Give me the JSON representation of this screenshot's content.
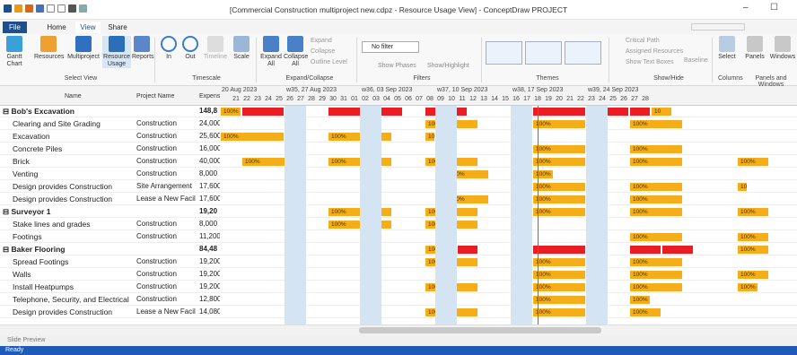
{
  "window": {
    "title": "[Commercial Construction multiproject new.cdpz - Resource Usage View] - ConceptDraw PROJECT",
    "min": "–",
    "max": "☐"
  },
  "tabs": [
    {
      "label": "File"
    },
    {
      "label": "Home"
    },
    {
      "label": "View"
    },
    {
      "label": "Share"
    }
  ],
  "ribbon": {
    "select_view": [
      {
        "label": "Gantt Chart"
      },
      {
        "label": "Resources"
      },
      {
        "label": "Multiproject"
      },
      {
        "label": "Resource Usage"
      },
      {
        "label": "Reports"
      }
    ],
    "select_view_label": "Select View",
    "timescale": [
      {
        "label": "In"
      },
      {
        "label": "Out"
      },
      {
        "label": "Timeline"
      },
      {
        "label": "Scale"
      }
    ],
    "timescale_label": "Timescale",
    "expand": [
      {
        "label": "Expand All"
      },
      {
        "label": "Collapse All"
      }
    ],
    "expand_small": [
      "Expand",
      "Collapse",
      "Outline Level"
    ],
    "expand_label": "Expand/Collapse",
    "filter_value": "No filter",
    "filters_small": [
      "Show Phases",
      "Show/Highlight"
    ],
    "filters_label": "Filters",
    "themes_label": "Themes",
    "showhide_small": [
      "Critical Path",
      "Assigned Resources",
      "Show Text Boxes",
      "Baseline"
    ],
    "showhide_label": "Show/Hide",
    "columns": [
      {
        "label": "Select"
      }
    ],
    "columns_label": "Columns",
    "windows": [
      {
        "label": "Panels"
      },
      {
        "label": "Windows"
      }
    ],
    "windows_label": "Panels and Windows"
  },
  "grid": {
    "headers": {
      "name": "Name",
      "project": "Project Name",
      "expense": "Expense"
    },
    "weeks": [
      "20 Aug 2023",
      "w35, 27 Aug 2023",
      "w36, 03 Sep 2023",
      "w37, 10 Sep 2023",
      "w38, 17 Sep 2023",
      "w39, 24 Sep 2023"
    ],
    "days": [
      "21",
      "22",
      "23",
      "24",
      "25",
      "26",
      "27",
      "28",
      "29",
      "30",
      "31",
      "01",
      "02",
      "03",
      "04",
      "05",
      "06",
      "07",
      "08",
      "09",
      "10",
      "11",
      "12",
      "13",
      "14",
      "15",
      "16",
      "17",
      "18",
      "19",
      "20",
      "21",
      "22",
      "23",
      "24",
      "25",
      "26",
      "27",
      "28"
    ],
    "rows": [
      {
        "name": "Bob's Excavation",
        "project": "",
        "expense": "148,8",
        "group": true,
        "bars": [
          {
            "s": 0,
            "w": 2,
            "c": "o",
            "t": "100%"
          },
          {
            "s": 2,
            "w": 4,
            "c": "r",
            "t": ""
          },
          {
            "s": 10,
            "w": 7,
            "c": "r",
            "t": ""
          },
          {
            "s": 19,
            "w": 2,
            "c": "r",
            "t": ""
          },
          {
            "s": 21,
            "w": 2,
            "c": "r",
            "t": ""
          },
          {
            "s": 29,
            "w": 2,
            "c": "r",
            "t": ""
          },
          {
            "s": 31,
            "w": 3,
            "c": "r",
            "t": ""
          },
          {
            "s": 38,
            "w": 2,
            "c": "r",
            "t": ""
          },
          {
            "s": 29,
            "w": 3,
            "c": "r",
            "t": ""
          },
          {
            "s": 35,
            "w": 3,
            "c": "r",
            "t": ""
          },
          {
            "s": 40,
            "w": 2,
            "c": "o",
            "t": "10"
          }
        ]
      },
      {
        "name": "Clearing and Site Grading",
        "project": "Construction",
        "expense": "24,000",
        "bars": [
          {
            "s": 19,
            "w": 5,
            "c": "o",
            "t": "100%"
          },
          {
            "s": 29,
            "w": 5,
            "c": "o",
            "t": "100%"
          },
          {
            "s": 38,
            "w": 5,
            "c": "o",
            "t": "100%"
          }
        ]
      },
      {
        "name": "Excavation",
        "project": "Construction",
        "expense": "25,600",
        "bars": [
          {
            "s": 0,
            "w": 6,
            "c": "o",
            "t": "100%"
          },
          {
            "s": 10,
            "w": 6,
            "c": "o",
            "t": "100%"
          },
          {
            "s": 19,
            "w": 1,
            "c": "o",
            "t": "10"
          }
        ]
      },
      {
        "name": "Concrete Piles",
        "project": "Construction",
        "expense": "16,000",
        "bars": [
          {
            "s": 29,
            "w": 5,
            "c": "o",
            "t": "100%"
          },
          {
            "s": 38,
            "w": 5,
            "c": "o",
            "t": "100%"
          }
        ]
      },
      {
        "name": "Brick",
        "project": "Construction",
        "expense": "40,000",
        "bars": [
          {
            "s": 2,
            "w": 5,
            "c": "o",
            "t": "100%"
          },
          {
            "s": 10,
            "w": 6,
            "c": "o",
            "t": "100%"
          },
          {
            "s": 19,
            "w": 5,
            "c": "o",
            "t": "100%"
          },
          {
            "s": 29,
            "w": 5,
            "c": "o",
            "t": "100%"
          },
          {
            "s": 38,
            "w": 5,
            "c": "o",
            "t": "100%"
          },
          {
            "s": 48,
            "w": 3,
            "c": "o",
            "t": "100%"
          }
        ]
      },
      {
        "name": "Venting",
        "project": "Construction",
        "expense": "8,000",
        "bars": [
          {
            "s": 21,
            "w": 4,
            "c": "o",
            "t": "100%"
          },
          {
            "s": 29,
            "w": 2,
            "c": "o",
            "t": "100%"
          }
        ]
      },
      {
        "name": "Design provides Construction",
        "project": "Site Arrangement",
        "expense": "17,600",
        "bars": [
          {
            "s": 29,
            "w": 5,
            "c": "o",
            "t": "100%"
          },
          {
            "s": 38,
            "w": 5,
            "c": "o",
            "t": "100%"
          },
          {
            "s": 48,
            "w": 1,
            "c": "o",
            "t": "10"
          }
        ]
      },
      {
        "name": "Design provides Construction",
        "project": "Lease a New Facility",
        "expense": "17,600",
        "bars": [
          {
            "s": 21,
            "w": 4,
            "c": "o",
            "t": "100%"
          },
          {
            "s": 29,
            "w": 5,
            "c": "o",
            "t": "100%"
          },
          {
            "s": 38,
            "w": 5,
            "c": "o",
            "t": "100%"
          },
          {
            "s": 38,
            "w": 3,
            "c": "o",
            "t": "100%"
          }
        ]
      },
      {
        "name": "Surveyor 1",
        "project": "",
        "expense": "19,20",
        "group": true,
        "bars": [
          {
            "s": 10,
            "w": 6,
            "c": "o",
            "t": "100%"
          },
          {
            "s": 19,
            "w": 5,
            "c": "o",
            "t": "100%"
          },
          {
            "s": 29,
            "w": 5,
            "c": "o",
            "t": "100%"
          },
          {
            "s": 38,
            "w": 5,
            "c": "o",
            "t": "100%"
          },
          {
            "s": 48,
            "w": 3,
            "c": "o",
            "t": "100%"
          }
        ]
      },
      {
        "name": "Stake lines and grades",
        "project": "Construction",
        "expense": "8,000",
        "bars": [
          {
            "s": 10,
            "w": 6,
            "c": "o",
            "t": "100%"
          },
          {
            "s": 19,
            "w": 5,
            "c": "o",
            "t": "100%"
          }
        ]
      },
      {
        "name": "Footings",
        "project": "Construction",
        "expense": "11,200",
        "bars": [
          {
            "s": 38,
            "w": 5,
            "c": "o",
            "t": "100%"
          },
          {
            "s": 48,
            "w": 3,
            "c": "o",
            "t": "100%"
          }
        ]
      },
      {
        "name": "Baker Flooring",
        "project": "",
        "expense": "84,48",
        "group": true,
        "bars": [
          {
            "s": 19,
            "w": 3,
            "c": "o",
            "t": "100%"
          },
          {
            "s": 22,
            "w": 2,
            "c": "r",
            "t": ""
          },
          {
            "s": 29,
            "w": 5,
            "c": "r",
            "t": ""
          },
          {
            "s": 38,
            "w": 3,
            "c": "r",
            "t": ""
          },
          {
            "s": 41,
            "w": 3,
            "c": "r",
            "t": ""
          },
          {
            "s": 48,
            "w": 3,
            "c": "o",
            "t": "100%"
          }
        ]
      },
      {
        "name": "Spread Footings",
        "project": "Construction",
        "expense": "19,200",
        "bars": [
          {
            "s": 19,
            "w": 5,
            "c": "o",
            "t": "100%"
          },
          {
            "s": 29,
            "w": 5,
            "c": "o",
            "t": "100%"
          },
          {
            "s": 38,
            "w": 5,
            "c": "o",
            "t": "100%"
          }
        ]
      },
      {
        "name": "Walls",
        "project": "Construction",
        "expense": "19,200",
        "bars": [
          {
            "s": 29,
            "w": 5,
            "c": "o",
            "t": "100%"
          },
          {
            "s": 38,
            "w": 5,
            "c": "o",
            "t": "100%"
          },
          {
            "s": 48,
            "w": 3,
            "c": "o",
            "t": "100%"
          }
        ]
      },
      {
        "name": "Install Heatpumps",
        "project": "Construction",
        "expense": "19,200",
        "bars": [
          {
            "s": 19,
            "w": 5,
            "c": "o",
            "t": "100%"
          },
          {
            "s": 29,
            "w": 5,
            "c": "o",
            "t": "100%"
          },
          {
            "s": 38,
            "w": 5,
            "c": "o",
            "t": "100%"
          },
          {
            "s": 48,
            "w": 2,
            "c": "o",
            "t": "100%"
          }
        ]
      },
      {
        "name": "Telephone, Security, and Electrical",
        "project": "Construction",
        "expense": "12,800",
        "bars": [
          {
            "s": 29,
            "w": 5,
            "c": "o",
            "t": "100%"
          },
          {
            "s": 38,
            "w": 2,
            "c": "o",
            "t": "100%"
          }
        ]
      },
      {
        "name": "Design provides Construction",
        "project": "Lease a New Facility",
        "expense": "14,080",
        "bars": [
          {
            "s": 19,
            "w": 5,
            "c": "o",
            "t": "100%"
          },
          {
            "s": 29,
            "w": 5,
            "c": "o",
            "t": "100%"
          },
          {
            "s": 38,
            "w": 3,
            "c": "o",
            "t": "100%"
          }
        ]
      }
    ]
  },
  "colors": {
    "orange": "#f5ae1a",
    "red": "#ea1c24",
    "shade": "#d5e4f2",
    "blue": "#1e5bb8"
  },
  "slide_preview": "Slide Preview",
  "status": "Ready"
}
